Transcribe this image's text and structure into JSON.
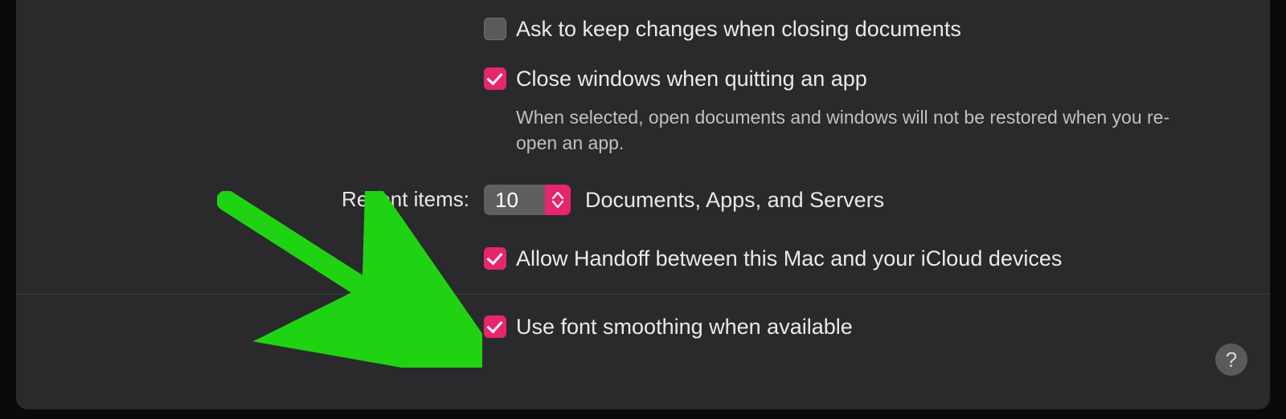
{
  "options": {
    "ask_keep_changes": {
      "label": "Ask to keep changes when closing documents",
      "checked": false
    },
    "close_windows": {
      "label": "Close windows when quitting an app",
      "checked": true,
      "description": "When selected, open documents and windows will not be restored when you re-open an app."
    },
    "recent_items": {
      "label": "Recent items:",
      "value": "10",
      "suffix": "Documents, Apps, and Servers"
    },
    "allow_handoff": {
      "label": "Allow Handoff between this Mac and your iCloud devices",
      "checked": true
    },
    "font_smoothing": {
      "label": "Use font smoothing when available",
      "checked": true
    }
  },
  "help_glyph": "?",
  "colors": {
    "accent": "#e6256f",
    "arrow": "#1fd312"
  }
}
